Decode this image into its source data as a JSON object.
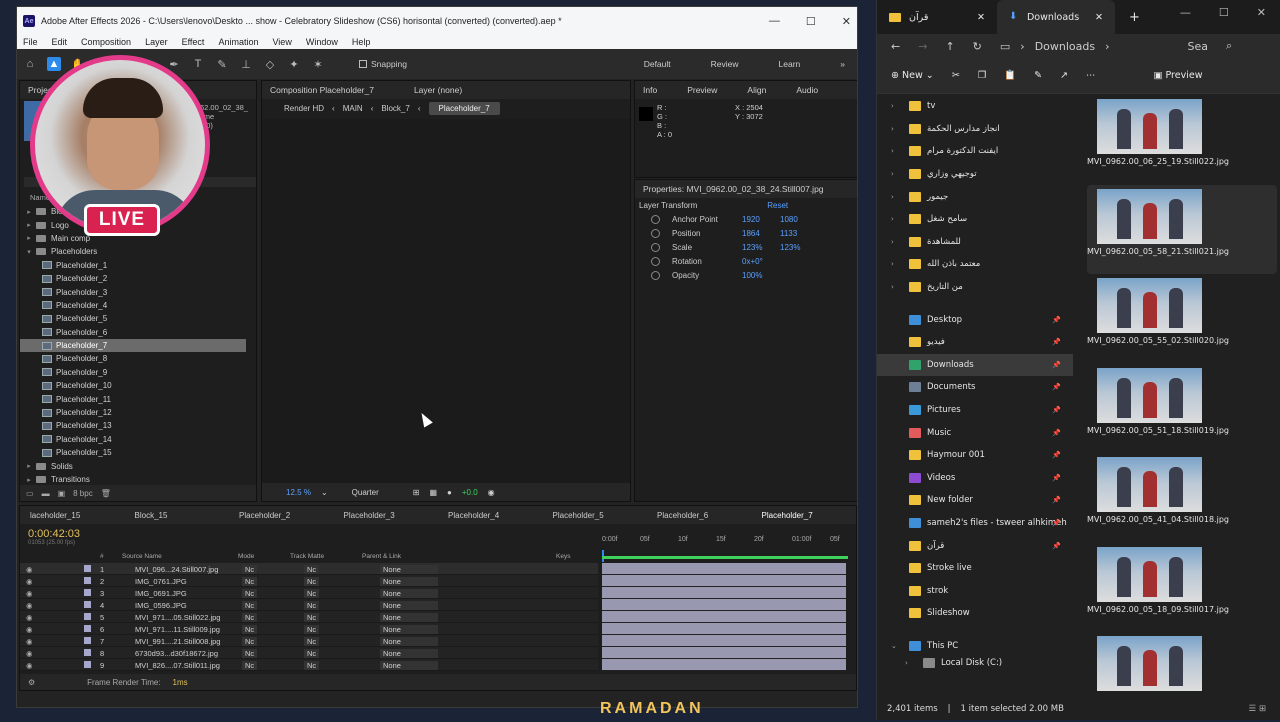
{
  "ae": {
    "title": "Adobe After Effects 2026 - C:\\Users\\lenovo\\Deskto ... show - Celebratory Slideshow (CS6) horisontal (converted) (converted).aep *",
    "menu": [
      "File",
      "Edit",
      "Composition",
      "Layer",
      "Effect",
      "Animation",
      "View",
      "Window",
      "Help"
    ],
    "snapping": "Snapping",
    "workspaces": [
      "Default",
      "Review",
      "Learn"
    ],
    "project_tab": "Projec",
    "project_info": [
      "62.00_02_38_",
      "time",
      ".00)"
    ],
    "project_col": "Name",
    "project_items": [
      {
        "label": "Blocks",
        "type": "folder",
        "twist": "▸"
      },
      {
        "label": "Logo",
        "type": "folder",
        "twist": "▸"
      },
      {
        "label": "Main comp",
        "type": "folder",
        "twist": "▸"
      },
      {
        "label": "Placeholders",
        "type": "folder",
        "twist": "▾"
      },
      {
        "label": "Placeholder_1",
        "type": "comp"
      },
      {
        "label": "Placeholder_2",
        "type": "comp"
      },
      {
        "label": "Placeholder_3",
        "type": "comp"
      },
      {
        "label": "Placeholder_4",
        "type": "comp"
      },
      {
        "label": "Placeholder_5",
        "type": "comp"
      },
      {
        "label": "Placeholder_6",
        "type": "comp"
      },
      {
        "label": "Placeholder_7",
        "type": "comp",
        "selected": true
      },
      {
        "label": "Placeholder_8",
        "type": "comp"
      },
      {
        "label": "Placeholder_9",
        "type": "comp"
      },
      {
        "label": "Placeholder_10",
        "type": "comp"
      },
      {
        "label": "Placeholder_11",
        "type": "comp"
      },
      {
        "label": "Placeholder_12",
        "type": "comp"
      },
      {
        "label": "Placeholder_13",
        "type": "comp"
      },
      {
        "label": "Placeholder_14",
        "type": "comp"
      },
      {
        "label": "Placeholder_15",
        "type": "comp"
      },
      {
        "label": "Solids",
        "type": "folder",
        "twist": "▸"
      },
      {
        "label": "Transitions",
        "type": "folder",
        "twist": "▸"
      }
    ],
    "project_bpc": "8 bpc",
    "comp_tab": "Composition Placeholder_7",
    "layer_tab": "Layer (none)",
    "crumbs": [
      "Render HD",
      "MAIN",
      "Block_7",
      "Placeholder_7"
    ],
    "comp_zoom": "12.5",
    "comp_zoom_unit": "%",
    "comp_quality": "Quarter",
    "comp_exposure": "+0.0",
    "info_tabs": [
      "Info",
      "Preview",
      "Align",
      "Audio"
    ],
    "info_rgba": [
      "R :",
      "G :",
      "B :",
      "A : 0"
    ],
    "info_xy": [
      "X : 2504",
      "Y : 3072"
    ],
    "props_title": "Properties: MVI_0962.00_02_38_24.Still007.jpg",
    "props_section": "Layer Transform",
    "props_reset": "Reset",
    "props": [
      {
        "name": "Anchor Point",
        "v1": "1920",
        "v2": "1080"
      },
      {
        "name": "Position",
        "v1": "1864",
        "v2": "1133"
      },
      {
        "name": "Scale",
        "v1": "123%",
        "v2": "123%"
      },
      {
        "name": "Rotation",
        "v1": "0x+0°",
        "v2": ""
      },
      {
        "name": "Opacity",
        "v1": "100%",
        "v2": ""
      }
    ],
    "tl_tabs": [
      "laceholder_15",
      "Block_15",
      "Placeholder_2",
      "Placeholder_3",
      "Placeholder_4",
      "Placeholder_5",
      "Placeholder_6",
      "Placeholder_7"
    ],
    "tl_time": "0:00:42:03",
    "tl_fps": "01053 (25.00 fps)",
    "tl_cols": {
      "num": "#",
      "src": "Source Name",
      "mode": "Mode",
      "tm": "Track Matte",
      "par": "Parent & Link",
      "keys": "Keys"
    },
    "tl_ruler": [
      "0:00f",
      "05f",
      "10f",
      "15f",
      "20f",
      "01:00f",
      "05f"
    ],
    "layers": [
      {
        "n": "1",
        "src": "MVI_096...24.Still007.jpg",
        "mode": "Nc",
        "tm": "Nc",
        "par": "None"
      },
      {
        "n": "2",
        "src": "IMG_0761.JPG",
        "mode": "Nc",
        "tm": "Nc",
        "par": "None"
      },
      {
        "n": "3",
        "src": "IMG_0691.JPG",
        "mode": "Nc",
        "tm": "Nc",
        "par": "None"
      },
      {
        "n": "4",
        "src": "IMG_0596.JPG",
        "mode": "Nc",
        "tm": "Nc",
        "par": "None"
      },
      {
        "n": "5",
        "src": "MVI_971....05.Still022.jpg",
        "mode": "Nc",
        "tm": "Nc",
        "par": "None"
      },
      {
        "n": "6",
        "src": "MVI_971....11.Still009.jpg",
        "mode": "Nc",
        "tm": "Nc",
        "par": "None"
      },
      {
        "n": "7",
        "src": "MVI_991....21.Still008.jpg",
        "mode": "Nc",
        "tm": "Nc",
        "par": "None"
      },
      {
        "n": "8",
        "src": "6730d93...d30f18672.jpg",
        "mode": "Nc",
        "tm": "Nc",
        "par": "None"
      },
      {
        "n": "9",
        "src": "MVI_826....07.Still011.jpg",
        "mode": "Nc",
        "tm": "Nc",
        "par": "None"
      }
    ],
    "render_label": "Frame Render Time:",
    "render_ms": "1ms"
  },
  "overlay": {
    "live": "LIVE"
  },
  "explorer": {
    "tabs": [
      "قرآن",
      "Downloads"
    ],
    "path": "Downloads",
    "search": "Sea",
    "cmd_new": "New",
    "cmd_preview": "Preview",
    "nav_folders": [
      "tv",
      "انجاز مدارس الحكمة",
      "ايفنت الدكتورة مرام",
      "توجيهي وزاري",
      "جيمور",
      "سامح شغل",
      "للمشاهدة",
      "معتمد باذن الله",
      "من التاريخ"
    ],
    "nav_quick": [
      {
        "label": "Desktop",
        "color": "#3f8fd8",
        "pin": true
      },
      {
        "label": "فيديو",
        "color": "#f0c23b",
        "pin": true
      },
      {
        "label": "Downloads",
        "color": "#2fa36b",
        "pin": true,
        "active": true
      },
      {
        "label": "Documents",
        "color": "#6d7f94",
        "pin": true
      },
      {
        "label": "Pictures",
        "color": "#3a9ad9",
        "pin": true
      },
      {
        "label": "Music",
        "color": "#e35a5a",
        "pin": true
      },
      {
        "label": "Haymour 001",
        "color": "#f0c23b",
        "pin": true
      },
      {
        "label": "Videos",
        "color": "#8c4bd1",
        "pin": true
      },
      {
        "label": "New folder",
        "color": "#f0c23b",
        "pin": true
      },
      {
        "label": "sameh2's files - tsweer alhkimeh",
        "color": "#3f8fd8",
        "pin": true
      },
      {
        "label": "قرآن",
        "color": "#f0c23b",
        "pin": true
      },
      {
        "label": "Stroke live",
        "color": "#f0c23b",
        "pin": false
      },
      {
        "label": "strok",
        "color": "#f0c23b",
        "pin": false
      },
      {
        "label": "Slideshow",
        "color": "#f0c23b",
        "pin": false
      }
    ],
    "nav_pc": "This PC",
    "nav_disk": "Local Disk (C:)",
    "files": [
      {
        "name": "MVI_0962.00_06_25_19.Still022.jpg"
      },
      {
        "name": "MVI_0962.00_05_58_21.Still021.jpg",
        "selected": true
      },
      {
        "name": "MVI_0962.00_05_55_02.Still020.jpg"
      },
      {
        "name": "MVI_0962.00_05_51_18.Still019.jpg"
      },
      {
        "name": "MVI_0962.00_05_41_04.Still018.jpg"
      },
      {
        "name": "MVI_0962.00_05_18_09.Still017.jpg"
      },
      {
        "name": ""
      }
    ],
    "status_items": "2,401 items",
    "status_sel": "1 item selected  2.00 MB"
  },
  "bg_text": "RAMADAN"
}
